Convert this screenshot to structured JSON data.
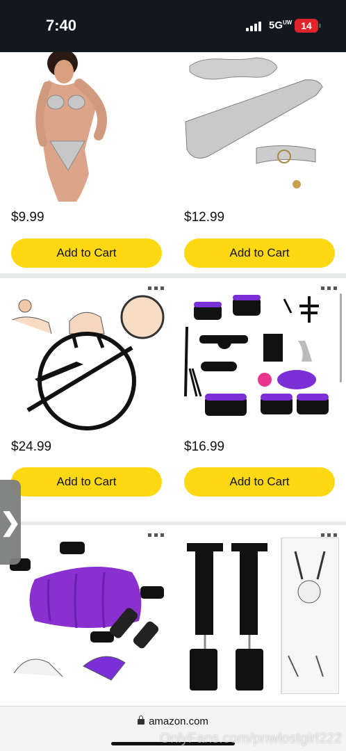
{
  "status_bar": {
    "time": "7:40",
    "network": "5G",
    "network_sup": "UW",
    "battery": "14"
  },
  "products": [
    {
      "price": "$9.99",
      "button": "Add to Cart",
      "image": "metallic-bikini-model"
    },
    {
      "price": "$12.99",
      "button": "Add to Cart",
      "image": "silver-blindfold-paddle-collar-set"
    },
    {
      "price": "$24.99",
      "button": "Add to Cart",
      "image": "black-hoop-restraint-bar"
    },
    {
      "price": "$16.99",
      "button": "Add to Cart",
      "image": "black-purple-restraint-kit"
    },
    {
      "image": "purple-inflatable-wedge-cuffs"
    },
    {
      "image": "door-strap-cuffs"
    }
  ],
  "more_icon": "ellipsis-icon",
  "side_tab_icon": "chevron-right-icon",
  "side_tab_glyph": "❯",
  "url_bar": {
    "domain": "amazon.com"
  },
  "watermark": "OnlyFans.com/pnwlostgirl222",
  "colors": {
    "add_to_cart": "#ffd814",
    "status_bar_bg": "#111820",
    "battery": "#e0242c",
    "accent_purple": "#7b2fd6"
  }
}
